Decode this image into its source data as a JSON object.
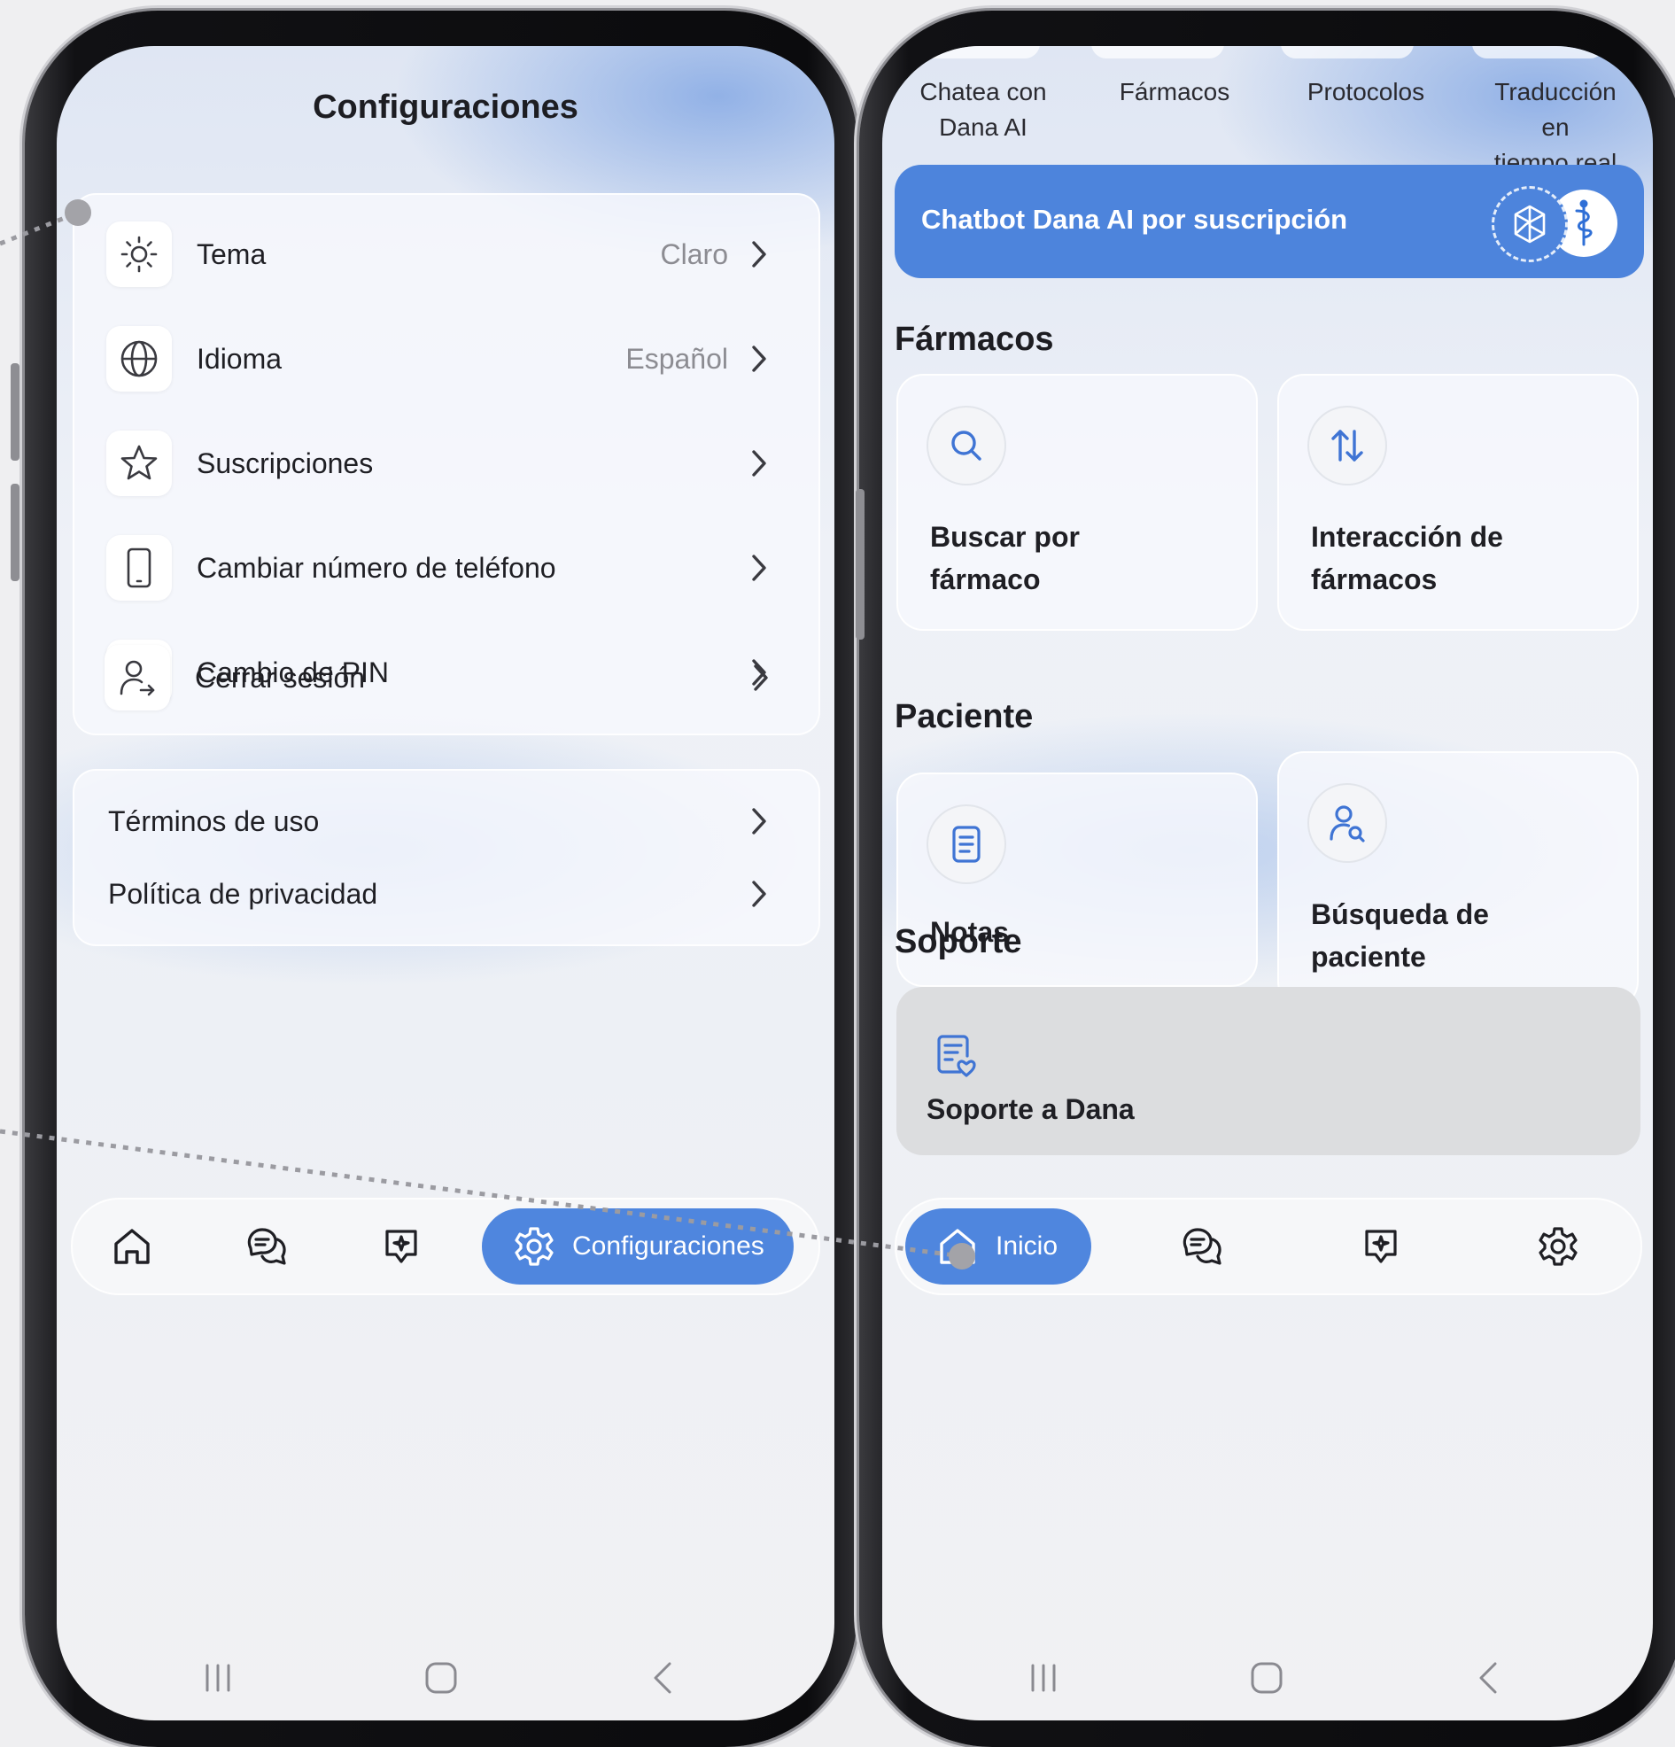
{
  "settings_screen": {
    "title": "Configuraciones",
    "items": [
      {
        "icon": "sun-icon",
        "label": "Tema",
        "value": "Claro"
      },
      {
        "icon": "globe-icon",
        "label": "Idioma",
        "value": "Español"
      },
      {
        "icon": "star-icon",
        "label": "Suscripciones",
        "value": ""
      },
      {
        "icon": "phone-icon",
        "label": "Cambiar número de teléfono",
        "value": ""
      },
      {
        "icon": "key-icon",
        "label": "Cambio de PIN",
        "value": ""
      },
      {
        "icon": "logout-user-icon",
        "label": "Cerrar sesión",
        "value": ""
      }
    ],
    "legal": [
      {
        "label": "Términos de uso"
      },
      {
        "label": "Política de privacidad"
      }
    ],
    "nav": {
      "active_label": "Configuraciones",
      "items": [
        "home-icon",
        "chat-icon",
        "ai-shield-icon",
        "gear-icon"
      ]
    }
  },
  "home_screen": {
    "tabs": [
      {
        "label": "Chatea con\nDana AI"
      },
      {
        "label": "Fármacos"
      },
      {
        "label": "Protocolos"
      },
      {
        "label": "Traducción en\ntiempo real"
      }
    ],
    "banner": {
      "text": "Chatbot Dana AI por suscripción",
      "icons": [
        "openai-icon",
        "medical-caduceus-icon"
      ]
    },
    "sections": {
      "farmacos": {
        "title": "Fármacos",
        "tiles": [
          {
            "icon": "search-icon",
            "label_1": "Buscar por",
            "label_2": "fármaco"
          },
          {
            "icon": "swap-arrows-icon",
            "label_1": "Interacción de",
            "label_2": "fármacos"
          }
        ]
      },
      "paciente": {
        "title": "Paciente",
        "tiles": [
          {
            "icon": "notes-icon",
            "label_1": "Notas"
          },
          {
            "icon": "user-search-icon",
            "label_1": "Búsqueda de",
            "label_2": "paciente"
          }
        ]
      },
      "soporte": {
        "title": "Soporte",
        "tile": {
          "icon": "support-document-heart-icon",
          "label": "Soporte a Dana"
        }
      }
    },
    "nav": {
      "active_label": "Inicio",
      "items": [
        "home-icon",
        "chat-icon",
        "ai-shield-icon",
        "gear-icon"
      ]
    }
  },
  "colors": {
    "accent": "#4f86de",
    "background": "#efeff1",
    "text": "#1d1d22",
    "muted": "#8c8c92"
  }
}
